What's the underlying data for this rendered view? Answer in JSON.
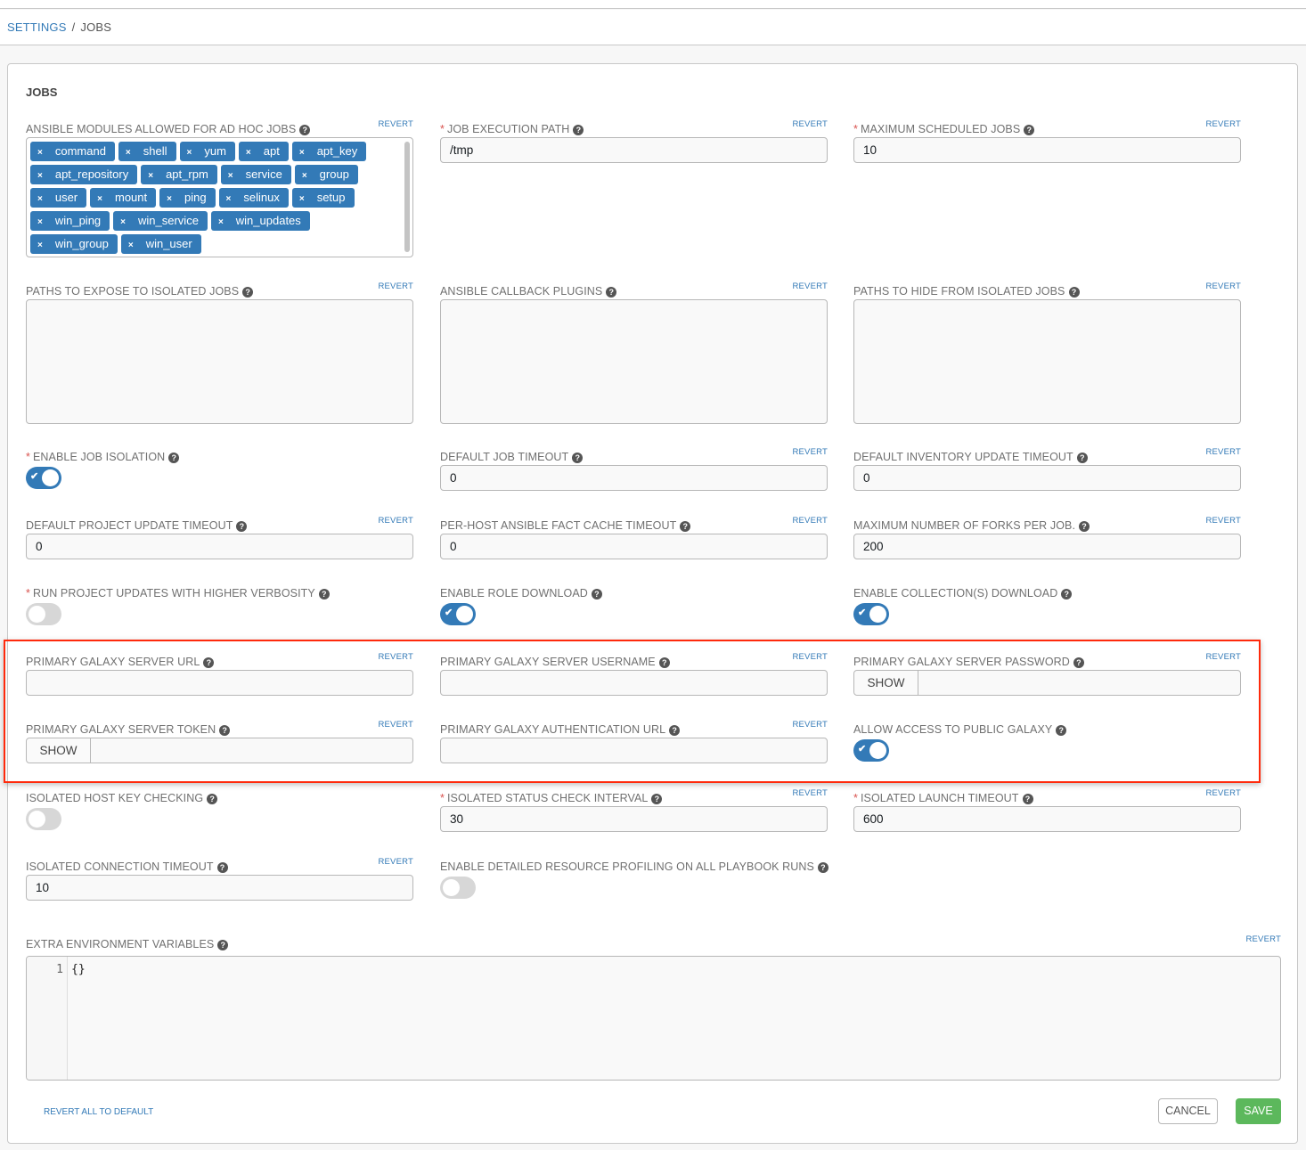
{
  "breadcrumb": {
    "parent": "SETTINGS",
    "separator": "/",
    "current": "JOBS"
  },
  "panel": {
    "title": "JOBS"
  },
  "revert_label": "REVERT",
  "help_glyph": "?",
  "required_glyph": "*",
  "show_label": "SHOW",
  "fields": {
    "adhoc_modules": {
      "label": "ANSIBLE MODULES ALLOWED FOR AD HOC JOBS",
      "tags": [
        "command",
        "shell",
        "yum",
        "apt",
        "apt_key",
        "apt_repository",
        "apt_rpm",
        "service",
        "group",
        "user",
        "mount",
        "ping",
        "selinux",
        "setup",
        "win_ping",
        "win_service",
        "win_updates",
        "win_group",
        "win_user"
      ]
    },
    "job_execution_path": {
      "label": "JOB EXECUTION PATH",
      "value": "/tmp",
      "required": true
    },
    "max_scheduled_jobs": {
      "label": "MAXIMUM SCHEDULED JOBS",
      "value": "10",
      "required": true
    },
    "paths_expose": {
      "label": "PATHS TO EXPOSE TO ISOLATED JOBS",
      "value": ""
    },
    "callback_plugins": {
      "label": "ANSIBLE CALLBACK PLUGINS",
      "value": ""
    },
    "paths_hide": {
      "label": "PATHS TO HIDE FROM ISOLATED JOBS",
      "value": ""
    },
    "enable_job_isolation": {
      "label": "ENABLE JOB ISOLATION",
      "enabled": true,
      "required": true
    },
    "default_job_timeout": {
      "label": "DEFAULT JOB TIMEOUT",
      "value": "0"
    },
    "default_inventory_timeout": {
      "label": "DEFAULT INVENTORY UPDATE TIMEOUT",
      "value": "0"
    },
    "default_project_timeout": {
      "label": "DEFAULT PROJECT UPDATE TIMEOUT",
      "value": "0"
    },
    "fact_cache_timeout": {
      "label": "PER-HOST ANSIBLE FACT CACHE TIMEOUT",
      "value": "0"
    },
    "max_forks": {
      "label": "MAXIMUM NUMBER OF FORKS PER JOB.",
      "value": "200"
    },
    "project_verbosity": {
      "label": "RUN PROJECT UPDATES WITH HIGHER VERBOSITY",
      "enabled": false,
      "required": true
    },
    "role_download": {
      "label": "ENABLE ROLE DOWNLOAD",
      "enabled": true
    },
    "collection_download": {
      "label": "ENABLE COLLECTION(S) DOWNLOAD",
      "enabled": true
    },
    "galaxy_url": {
      "label": "PRIMARY GALAXY SERVER URL",
      "value": ""
    },
    "galaxy_username": {
      "label": "PRIMARY GALAXY SERVER USERNAME",
      "value": ""
    },
    "galaxy_password": {
      "label": "PRIMARY GALAXY SERVER PASSWORD",
      "value": ""
    },
    "galaxy_token": {
      "label": "PRIMARY GALAXY SERVER TOKEN",
      "value": ""
    },
    "galaxy_auth_url": {
      "label": "PRIMARY GALAXY AUTHENTICATION URL",
      "value": ""
    },
    "public_galaxy": {
      "label": "ALLOW ACCESS TO PUBLIC GALAXY",
      "enabled": true
    },
    "isolated_host_key": {
      "label": "ISOLATED HOST KEY CHECKING",
      "enabled": false
    },
    "isolated_status_interval": {
      "label": "ISOLATED STATUS CHECK INTERVAL",
      "value": "30",
      "required": true
    },
    "isolated_launch_timeout": {
      "label": "ISOLATED LAUNCH TIMEOUT",
      "value": "600",
      "required": true
    },
    "isolated_connection_timeout": {
      "label": "ISOLATED CONNECTION TIMEOUT",
      "value": "10"
    },
    "resource_profiling": {
      "label": "ENABLE DETAILED RESOURCE PROFILING ON ALL PLAYBOOK RUNS",
      "enabled": false
    },
    "extra_env": {
      "label": "EXTRA ENVIRONMENT VARIABLES",
      "line_number": "1",
      "code": "{}"
    }
  },
  "footer": {
    "revert_all": "REVERT ALL TO DEFAULT",
    "cancel": "CANCEL",
    "save": "SAVE"
  },
  "colors": {
    "accent": "#337ab7",
    "save": "#5cb85c",
    "required": "#d9534f",
    "highlight": "#ff2a0c"
  }
}
